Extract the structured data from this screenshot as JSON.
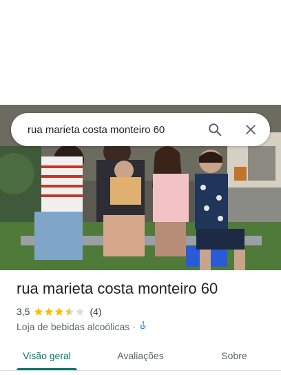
{
  "search": {
    "query": "rua marieta costa monteiro 60"
  },
  "place": {
    "title": "rua marieta costa monteiro 60",
    "rating": "3,5",
    "rating_value": 3.5,
    "review_count": "(4)",
    "category": "Loja de bebidas alcoólicas",
    "separator": "·",
    "accessibility_icon": "wheelchair-icon"
  },
  "tabs": [
    {
      "label": "Visão geral",
      "active": true
    },
    {
      "label": "Avaliações",
      "active": false
    },
    {
      "label": "Sobre",
      "active": false
    }
  ],
  "colors": {
    "accent": "#00796b",
    "star": "#fbbc04",
    "star_empty": "#dadce0",
    "accessibility": "#1a73e8"
  }
}
